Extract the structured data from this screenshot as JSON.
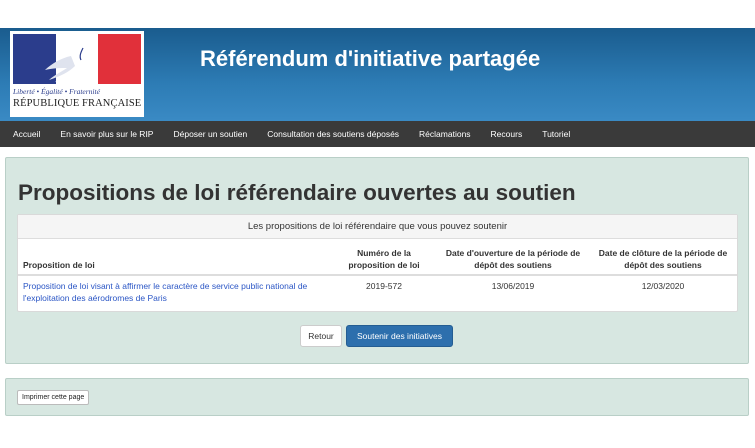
{
  "header": {
    "title": "Référendum d'initiative partagée",
    "logo": {
      "motto": "Liberté • Égalité • Fraternité",
      "republic": "RÉPUBLIQUE FRANÇAISE",
      "colors": {
        "blue": "#2b3d8c",
        "white": "#ffffff",
        "red": "#e1303a"
      }
    }
  },
  "nav": {
    "items": [
      "Accueil",
      "En savoir plus sur le RIP",
      "Déposer un soutien",
      "Consultation des soutiens déposés",
      "Réclamations",
      "Recours",
      "Tutoriel"
    ]
  },
  "main": {
    "heading": "Propositions de loi référendaire ouvertes au soutien",
    "table": {
      "caption": "Les propositions de loi référendaire que vous pouvez soutenir",
      "columns": [
        "Proposition de loi",
        "Numéro de la proposition de loi",
        "Date d'ouverture de la période de dépôt des soutiens",
        "Date de clôture de la période de dépôt des soutiens"
      ],
      "rows": [
        {
          "title": "Proposition de loi visant à affirmer le caractère de service public national de l'exploitation des aérodromes de Paris",
          "number": "2019-572",
          "open_date": "13/06/2019",
          "close_date": "12/03/2020"
        }
      ]
    },
    "buttons": {
      "back": "Retour",
      "support": "Soutenir des initiatives"
    }
  },
  "footer": {
    "print": "Imprimer cette page"
  },
  "colors": {
    "header_blue": "#1a5c8e",
    "navbar": "#3a3a3a",
    "panel": "#d7e7e1",
    "link": "#2b56c5",
    "primary_button": "#2d6fad"
  }
}
